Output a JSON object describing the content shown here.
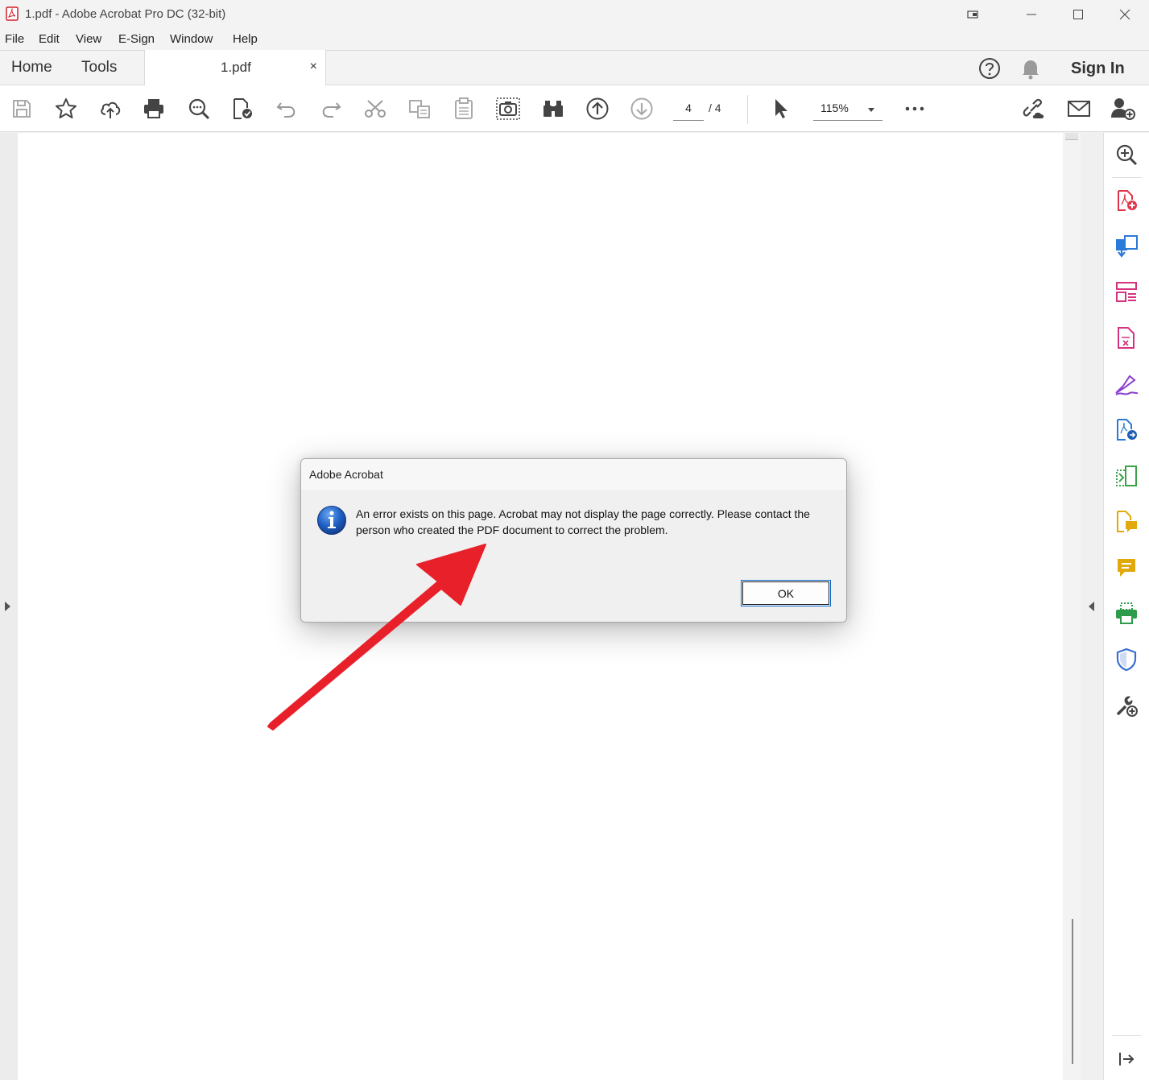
{
  "window": {
    "title": "1.pdf - Adobe Acrobat Pro DC (32-bit)"
  },
  "menu": [
    "File",
    "Edit",
    "View",
    "E-Sign",
    "Window",
    "Help"
  ],
  "tabs": {
    "home": "Home",
    "tools": "Tools",
    "document": "1.pdf",
    "close_glyph": "×",
    "sign_in": "Sign In"
  },
  "toolbar": {
    "current_page": "4",
    "page_total": "/ 4",
    "zoom": "115%",
    "icons": [
      "save-icon",
      "star-icon",
      "upload-cloud-icon",
      "print-icon",
      "zoom-search-icon",
      "spellcheck-icon",
      "undo-icon",
      "redo-icon",
      "cut-icon",
      "copy-icon",
      "paste-icon",
      "snapshot-icon",
      "find-binoculars-icon",
      "page-up-icon",
      "page-down-icon",
      "select-cursor-icon",
      "more-icon",
      "share-link-icon",
      "email-icon",
      "add-user-icon"
    ]
  },
  "right_pane": {
    "icons": [
      "zoom-in-tool-icon",
      "create-pdf-icon",
      "export-pdf-icon",
      "organize-pages-icon",
      "edit-pdf-icon",
      "fill-sign-icon",
      "send-for-signature-icon",
      "compare-files-icon",
      "send-for-comments-icon",
      "comment-icon",
      "print-production-icon",
      "protect-icon",
      "more-tools-icon",
      "collapse-pane-icon"
    ]
  },
  "dialog": {
    "title": "Adobe Acrobat",
    "message": "An error exists on this page. Acrobat may not display the page correctly. Please contact the person who created the PDF document to correct the problem.",
    "ok_label": "OK"
  },
  "colors": {
    "annotation_arrow": "#e8202a",
    "dialog_button_border": "#0a64c8"
  }
}
